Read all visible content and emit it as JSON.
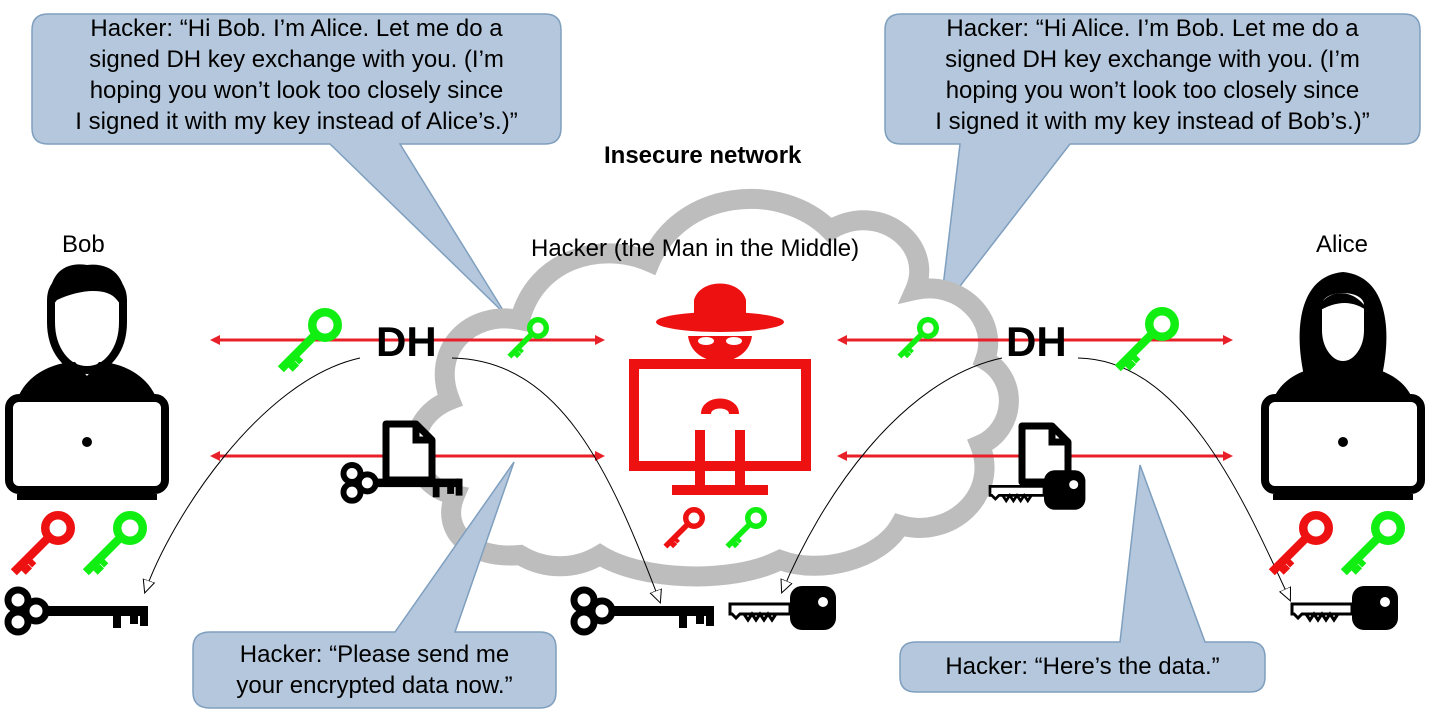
{
  "title": "Insecure network",
  "labels": {
    "bob": "Bob",
    "alice": "Alice",
    "hacker": "Hacker (the Man in the Middle)",
    "dh_left": "DH",
    "dh_right": "DH"
  },
  "bubbles": {
    "top_left": [
      "Hacker: “Hi Bob. I’m Alice. Let me do a",
      "signed DH key exchange with you. (I’m",
      "hoping you won’t look too closely since",
      "I signed it with my key instead of Alice’s.)”"
    ],
    "top_right": [
      "Hacker: “Hi Alice. I’m Bob. Let me do a",
      "signed DH key exchange with you. (I’m",
      "hoping you won’t look too closely since",
      "I signed it with my key instead of Bob’s.)”"
    ],
    "bottom_left": [
      "Hacker: “Please send me",
      "your encrypted data now.”"
    ],
    "bottom_right": [
      "Hacker: “Here’s the data.”"
    ]
  },
  "colors": {
    "bubble_fill": "#b4c7dc",
    "bubble_stroke": "#7f9fbf",
    "arrow": "#e8202a",
    "key_red": "#ee1111",
    "key_green": "#11ee11",
    "hacker": "#ee1111",
    "cloud": "#bdbdbd"
  }
}
